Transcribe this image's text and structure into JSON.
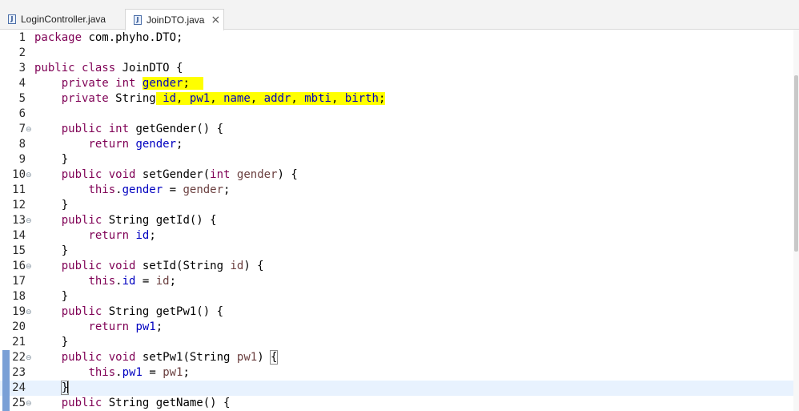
{
  "tabs": [
    {
      "label": "LoginController.java",
      "active": false
    },
    {
      "label": "JoinDTO.java",
      "active": true
    }
  ],
  "close_glyph": "×",
  "file_icon_glyph": "J",
  "fold_glyph": "⊖",
  "editor": {
    "lines": [
      {
        "n": "1",
        "tokens": [
          [
            "kw",
            "package"
          ],
          [
            "t",
            " com.phyho.DTO;"
          ]
        ]
      },
      {
        "n": "2",
        "tokens": []
      },
      {
        "n": "3",
        "tokens": [
          [
            "kw",
            "public"
          ],
          [
            "t",
            " "
          ],
          [
            "kw",
            "class"
          ],
          [
            "t",
            " JoinDTO {"
          ]
        ]
      },
      {
        "n": "4",
        "tokens": [
          [
            "t",
            "    "
          ],
          [
            "kw",
            "private"
          ],
          [
            "t",
            " "
          ],
          [
            "kw",
            "int"
          ],
          [
            "t",
            " "
          ],
          [
            "fld hl",
            "gender"
          ],
          [
            "hl",
            ";  "
          ]
        ]
      },
      {
        "n": "5",
        "tokens": [
          [
            "t",
            "    "
          ],
          [
            "kw",
            "private"
          ],
          [
            "t",
            " String"
          ],
          [
            "hl",
            " "
          ],
          [
            "fld hl",
            "id"
          ],
          [
            "hl",
            ", "
          ],
          [
            "fld hl",
            "pw1"
          ],
          [
            "hl",
            ", "
          ],
          [
            "fld hl",
            "name"
          ],
          [
            "hl",
            ", "
          ],
          [
            "fld hl",
            "addr"
          ],
          [
            "hl",
            ", "
          ],
          [
            "fld hl",
            "mbti"
          ],
          [
            "hl",
            ", "
          ],
          [
            "fld hl",
            "birth"
          ],
          [
            "hl",
            ";"
          ]
        ]
      },
      {
        "n": "6",
        "tokens": []
      },
      {
        "n": "7",
        "fold": true,
        "tokens": [
          [
            "t",
            "    "
          ],
          [
            "kw",
            "public"
          ],
          [
            "t",
            " "
          ],
          [
            "kw",
            "int"
          ],
          [
            "t",
            " getGender() {"
          ]
        ]
      },
      {
        "n": "8",
        "tokens": [
          [
            "t",
            "        "
          ],
          [
            "kw",
            "return"
          ],
          [
            "t",
            " "
          ],
          [
            "fld",
            "gender"
          ],
          [
            "t",
            ";"
          ]
        ]
      },
      {
        "n": "9",
        "tokens": [
          [
            "t",
            "    }"
          ]
        ]
      },
      {
        "n": "10",
        "fold": true,
        "tokens": [
          [
            "t",
            "    "
          ],
          [
            "kw",
            "public"
          ],
          [
            "t",
            " "
          ],
          [
            "kw",
            "void"
          ],
          [
            "t",
            " setGender("
          ],
          [
            "kw",
            "int"
          ],
          [
            "t",
            " "
          ],
          [
            "param",
            "gender"
          ],
          [
            "t",
            ") {"
          ]
        ]
      },
      {
        "n": "11",
        "tokens": [
          [
            "t",
            "        "
          ],
          [
            "kw",
            "this"
          ],
          [
            "t",
            "."
          ],
          [
            "fld",
            "gender"
          ],
          [
            "t",
            " = "
          ],
          [
            "param",
            "gender"
          ],
          [
            "t",
            ";"
          ]
        ]
      },
      {
        "n": "12",
        "tokens": [
          [
            "t",
            "    }"
          ]
        ]
      },
      {
        "n": "13",
        "fold": true,
        "tokens": [
          [
            "t",
            "    "
          ],
          [
            "kw",
            "public"
          ],
          [
            "t",
            " String getId() {"
          ]
        ]
      },
      {
        "n": "14",
        "tokens": [
          [
            "t",
            "        "
          ],
          [
            "kw",
            "return"
          ],
          [
            "t",
            " "
          ],
          [
            "fld",
            "id"
          ],
          [
            "t",
            ";"
          ]
        ]
      },
      {
        "n": "15",
        "tokens": [
          [
            "t",
            "    }"
          ]
        ]
      },
      {
        "n": "16",
        "fold": true,
        "tokens": [
          [
            "t",
            "    "
          ],
          [
            "kw",
            "public"
          ],
          [
            "t",
            " "
          ],
          [
            "kw",
            "void"
          ],
          [
            "t",
            " setId(String "
          ],
          [
            "param",
            "id"
          ],
          [
            "t",
            ") {"
          ]
        ]
      },
      {
        "n": "17",
        "tokens": [
          [
            "t",
            "        "
          ],
          [
            "kw",
            "this"
          ],
          [
            "t",
            "."
          ],
          [
            "fld",
            "id"
          ],
          [
            "t",
            " = "
          ],
          [
            "param",
            "id"
          ],
          [
            "t",
            ";"
          ]
        ]
      },
      {
        "n": "18",
        "tokens": [
          [
            "t",
            "    }"
          ]
        ]
      },
      {
        "n": "19",
        "fold": true,
        "tokens": [
          [
            "t",
            "    "
          ],
          [
            "kw",
            "public"
          ],
          [
            "t",
            " String getPw1() {"
          ]
        ]
      },
      {
        "n": "20",
        "tokens": [
          [
            "t",
            "        "
          ],
          [
            "kw",
            "return"
          ],
          [
            "t",
            " "
          ],
          [
            "fld",
            "pw1"
          ],
          [
            "t",
            ";"
          ]
        ]
      },
      {
        "n": "21",
        "tokens": [
          [
            "t",
            "    }"
          ]
        ]
      },
      {
        "n": "22",
        "fold": true,
        "mark": true,
        "tokens": [
          [
            "t",
            "    "
          ],
          [
            "kw",
            "public"
          ],
          [
            "t",
            " "
          ],
          [
            "kw",
            "void"
          ],
          [
            "t",
            " setPw1(String "
          ],
          [
            "param",
            "pw1"
          ],
          [
            "t",
            ") "
          ],
          [
            "bracket-box",
            "{"
          ]
        ]
      },
      {
        "n": "23",
        "mark": true,
        "tokens": [
          [
            "t",
            "        "
          ],
          [
            "kw",
            "this"
          ],
          [
            "t",
            "."
          ],
          [
            "fld",
            "pw1"
          ],
          [
            "t",
            " = "
          ],
          [
            "param",
            "pw1"
          ],
          [
            "t",
            ";"
          ]
        ]
      },
      {
        "n": "24",
        "mark": true,
        "current": true,
        "cursor": true,
        "tokens": [
          [
            "t",
            "    "
          ],
          [
            "bracket-box",
            "}"
          ]
        ]
      },
      {
        "n": "25",
        "fold": true,
        "mark": true,
        "tokens": [
          [
            "t",
            "    "
          ],
          [
            "kw",
            "public"
          ],
          [
            "t",
            " String getName() {"
          ]
        ]
      }
    ]
  }
}
